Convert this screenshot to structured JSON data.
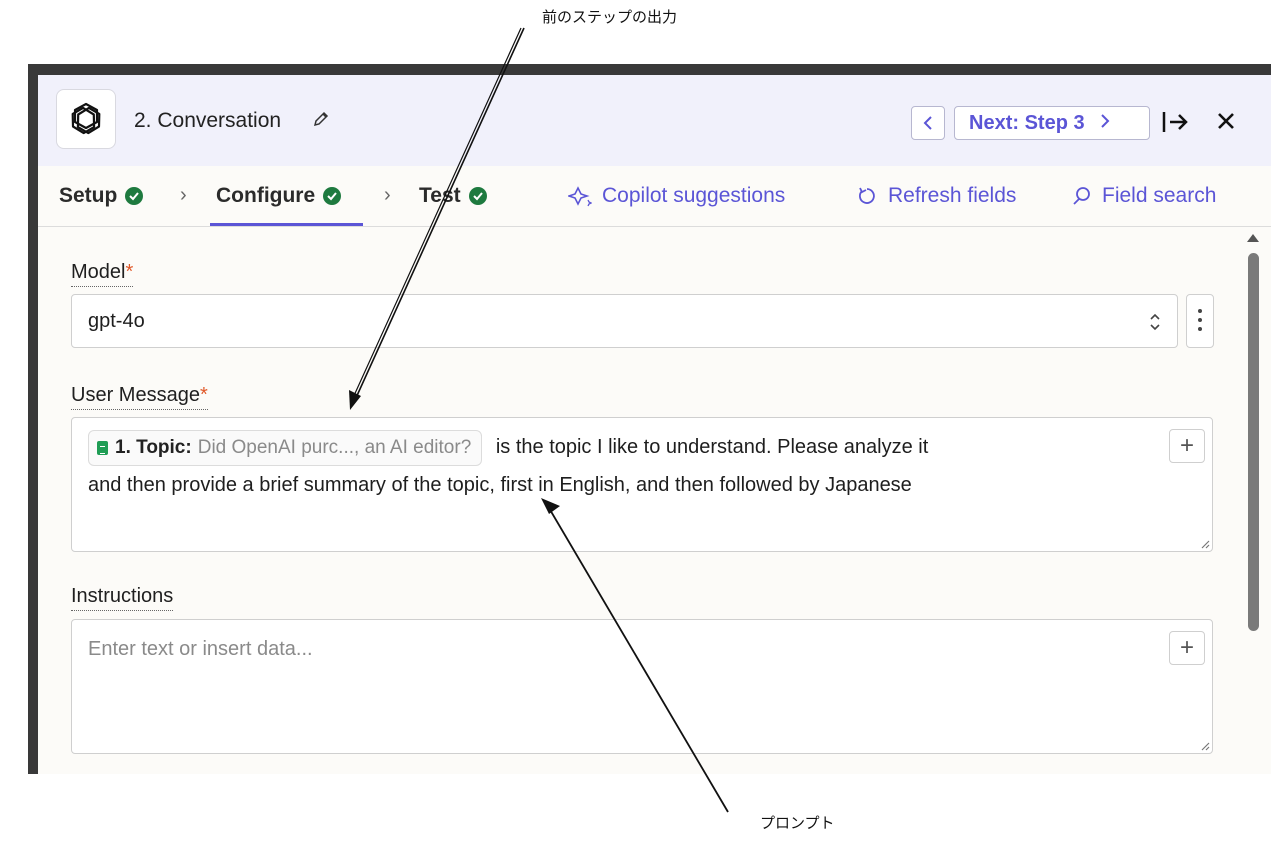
{
  "annotations": {
    "top": "前のステップの出力",
    "bottom": "プロンプト"
  },
  "header": {
    "app_icon": "openai-logo-icon",
    "step_title": "2. Conversation",
    "edit_icon": "pencil-icon",
    "prev_icon": "chevron-left-icon",
    "next_label": "Next: Step 3",
    "next_icon": "chevron-right-icon",
    "exit_icon": "exit-panel-icon",
    "close_icon": "close-icon"
  },
  "tabs": [
    {
      "label": "Setup",
      "status": "complete"
    },
    {
      "label": "Configure",
      "status": "complete",
      "active": true
    },
    {
      "label": "Test",
      "status": "complete"
    }
  ],
  "actions": {
    "copilot": "Copilot suggestions",
    "refresh": "Refresh fields",
    "search": "Field search"
  },
  "model": {
    "label": "Model",
    "required_mark": "*",
    "value": "gpt-4o"
  },
  "user_message": {
    "label": "User Message",
    "required_mark": "*",
    "pill_key": "1. Topic:",
    "pill_value": "Did OpenAI purc..., an AI editor?",
    "text_line1": "is the topic I like to understand. Please analyze it",
    "text_line2": "and then provide a brief summary of the topic, first in English, and then followed by Japanese",
    "add_button": "+"
  },
  "instructions": {
    "label": "Instructions",
    "placeholder": "Enter text or insert data...",
    "add_button": "+"
  },
  "colors": {
    "accent": "#5b55d6",
    "success": "#1e7a3f",
    "required": "#e0592a",
    "header_bg": "#f1f1fb"
  }
}
